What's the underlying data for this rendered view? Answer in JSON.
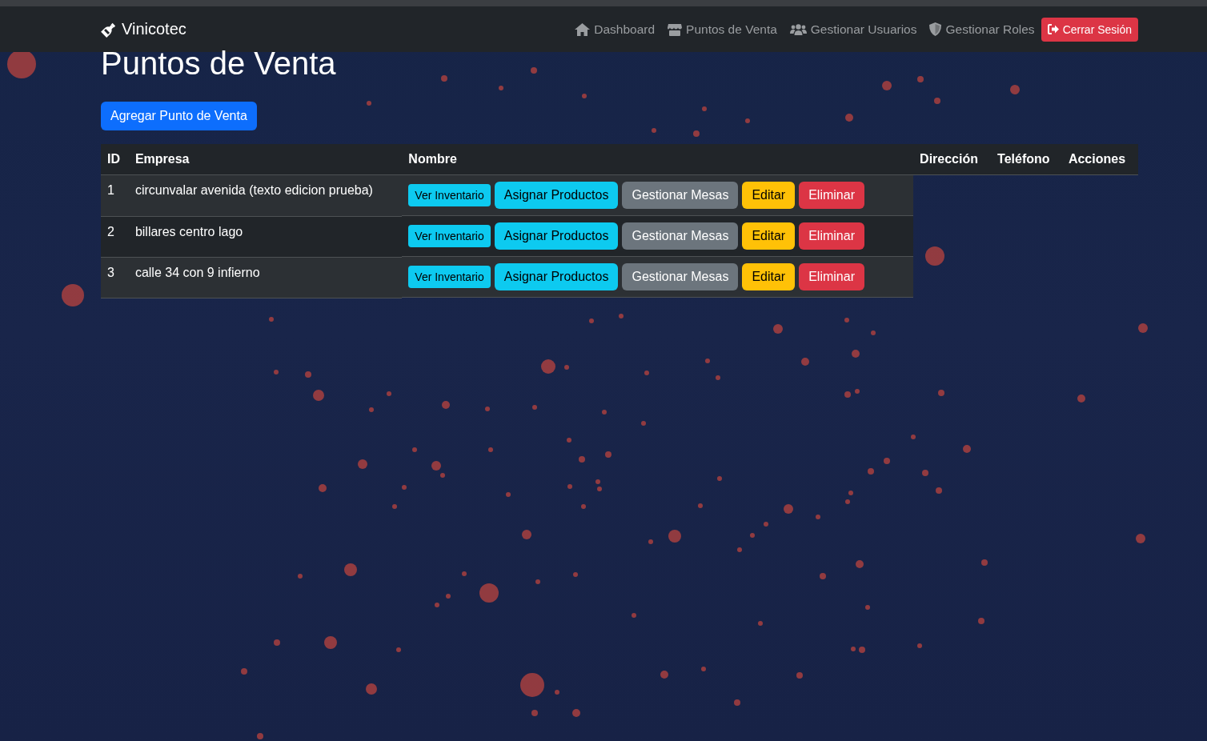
{
  "navbar": {
    "brand": "Vinicotec",
    "links": [
      {
        "label": "Dashboard"
      },
      {
        "label": "Puntos de Venta"
      },
      {
        "label": "Gestionar Usuarios"
      },
      {
        "label": "Gestionar Roles"
      }
    ],
    "logout": "Cerrar Sesión"
  },
  "page_title": "Puntos de Venta",
  "add_button": "Agregar Punto de Venta",
  "table": {
    "columns": [
      "ID",
      "Empresa",
      "Nombre",
      "Dirección",
      "Teléfono",
      "Acciones"
    ],
    "rows": [
      {
        "id": "1",
        "empresa": "circunvalar avenida (texto edicion prueba)",
        "actions": [
          {
            "label": "Ver Inventario",
            "kind": "info-small"
          },
          {
            "label": "Asignar Productos",
            "kind": "info"
          },
          {
            "label": "Gestionar Mesas",
            "kind": "secondary"
          },
          {
            "label": "Editar",
            "kind": "warning"
          },
          {
            "label": "Eliminar",
            "kind": "danger"
          }
        ]
      },
      {
        "id": "2",
        "empresa": "billares centro lago",
        "actions": [
          {
            "label": "Ver Inventario",
            "kind": "info-small"
          },
          {
            "label": "Asignar Productos",
            "kind": "info"
          },
          {
            "label": "Gestionar Mesas",
            "kind": "secondary"
          },
          {
            "label": "Editar",
            "kind": "warning"
          },
          {
            "label": "Eliminar",
            "kind": "danger"
          }
        ]
      },
      {
        "id": "3",
        "empresa": "calle 34 con 9 infierno",
        "actions": [
          {
            "label": "Ver Inventario",
            "kind": "info-small"
          },
          {
            "label": "Asignar Productos",
            "kind": "info"
          },
          {
            "label": "Gestionar Mesas",
            "kind": "secondary"
          },
          {
            "label": "Editar",
            "kind": "warning"
          },
          {
            "label": "Eliminar",
            "kind": "danger"
          }
        ]
      }
    ]
  }
}
